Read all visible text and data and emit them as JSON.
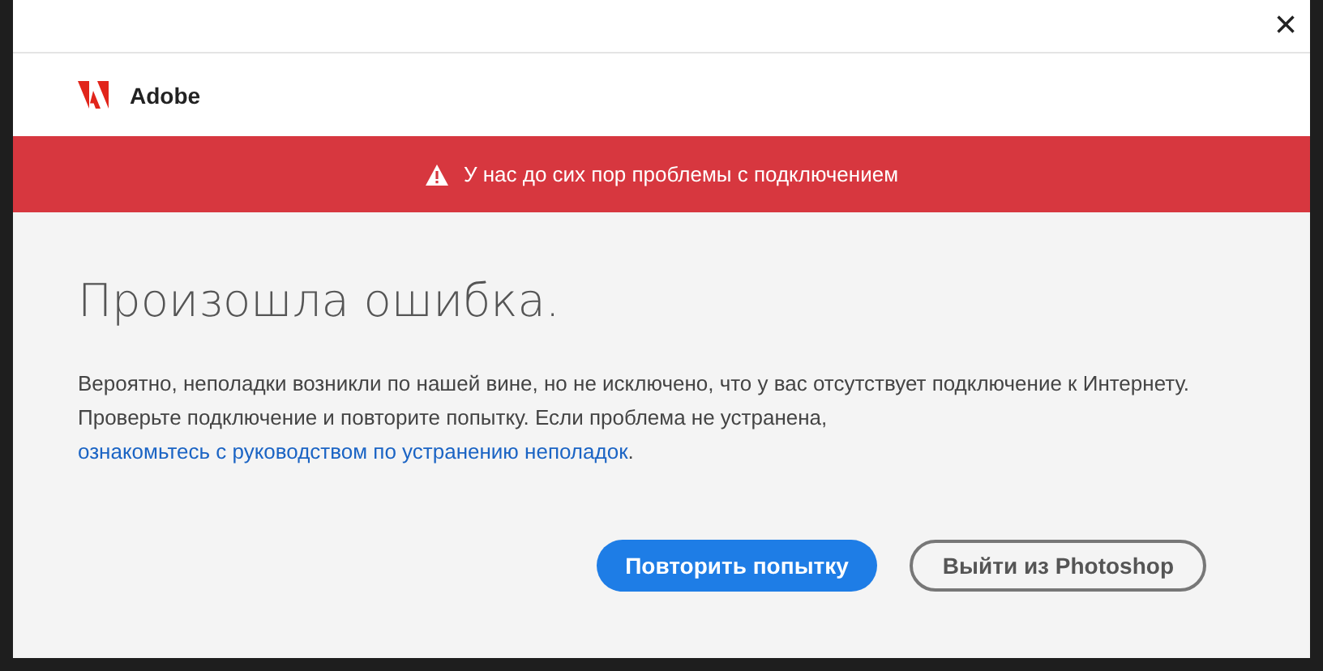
{
  "window": {
    "close": "×"
  },
  "header": {
    "brand": "Adobe"
  },
  "banner": {
    "text": "У нас до сих пор проблемы с подключением"
  },
  "content": {
    "title": "Произошла ошибка.",
    "message": "Вероятно, неполадки возникли по нашей вине, но не исключено, что у вас отсутствует подключение к Интернету. Проверьте подключение и повторите попытку. Если проблема не устранена,",
    "link": "ознакомьтесь с руководством по устранению неполадок",
    "message_end": "."
  },
  "buttons": [
    {
      "label": "Повторить попытку",
      "kind": "primary"
    },
    {
      "label": "Выйти из Photoshop",
      "kind": "secondary"
    }
  ]
}
